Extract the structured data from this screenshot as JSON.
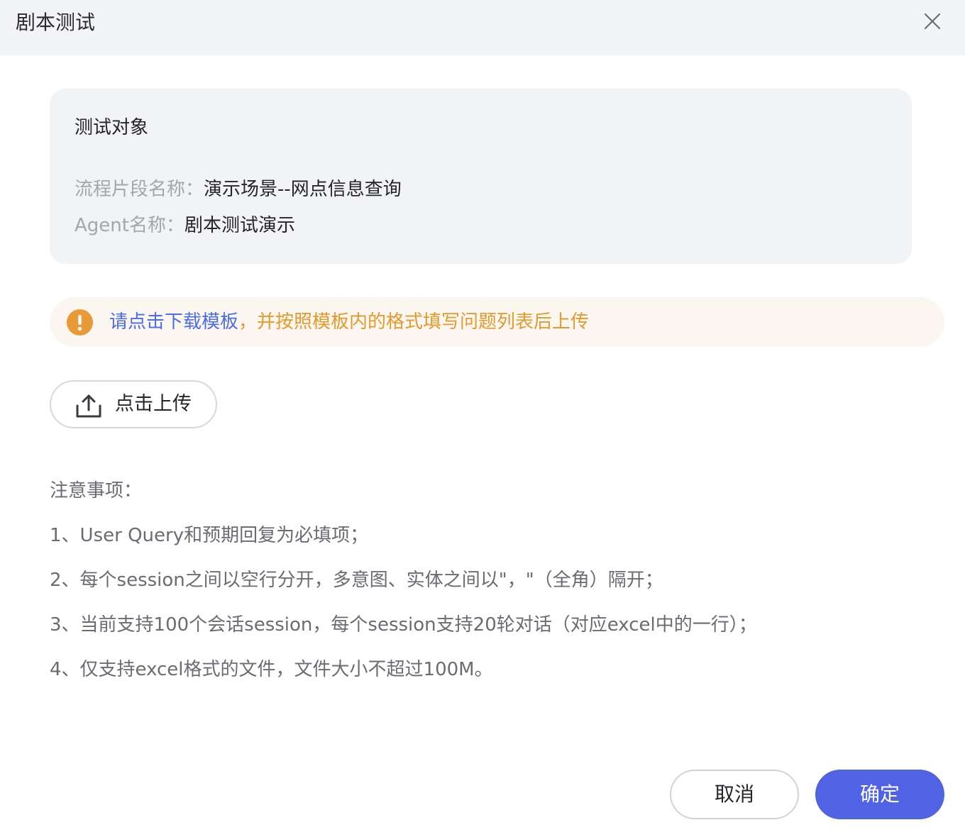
{
  "dialog": {
    "title": "剧本测试",
    "close_icon": "close-icon"
  },
  "test_target": {
    "title": "测试对象",
    "fields": [
      {
        "label": "流程片段名称：",
        "value": "演示场景--网点信息查询"
      },
      {
        "label": "Agent名称：",
        "value": "剧本测试演示"
      }
    ]
  },
  "notice": {
    "icon": "exclamation-circle-icon",
    "link_text": "请点击下载模板",
    "rest_text": "，并按照模板内的格式填写问题列表后上传",
    "colors": {
      "link": "#4b6ee6",
      "text": "#e39a2e",
      "background": "#fbf6ef",
      "icon": "#e89a36"
    }
  },
  "upload": {
    "icon": "upload-icon",
    "label": "点击上传"
  },
  "notes": {
    "title": "注意事项：",
    "items": [
      "1、User Query和预期回复为必填项；",
      "2、每个session之间以空行分开，多意图、实体之间以\"，\"（全角）隔开；",
      "3、当前支持100个会话session，每个session支持20轮对话（对应excel中的一行）；",
      "4、仅支持excel格式的文件，文件大小不超过100M。"
    ]
  },
  "footer": {
    "cancel_label": "取消",
    "ok_label": "确定",
    "colors": {
      "primary": "#4f63e4"
    }
  }
}
